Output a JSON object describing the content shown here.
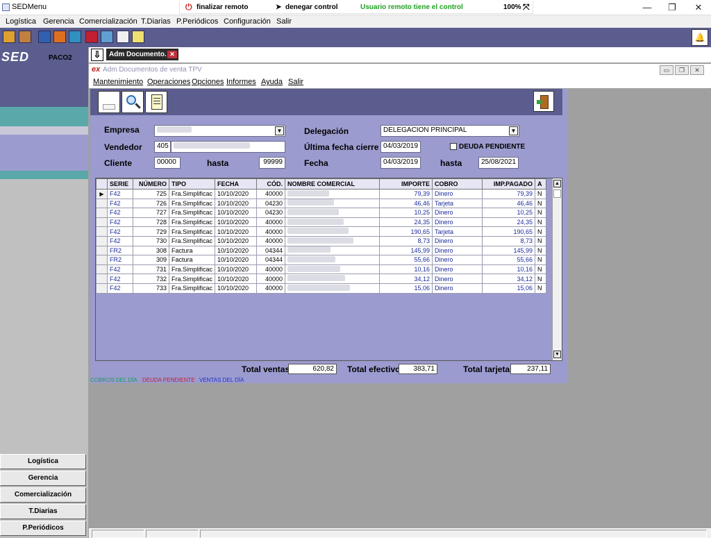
{
  "window": {
    "title": "SEDMenu",
    "minimize": "—",
    "restore": "❐",
    "close": "✕"
  },
  "remote": {
    "end_remote": "finalizar remoto",
    "deny_control": "denegar control",
    "status": "Usuario remoto tiene el control",
    "zoom": "100%",
    "pin": "⤧"
  },
  "main_menu": [
    "Logística",
    "Gerencia",
    "Comercialización",
    "T.Diarias",
    "P.Periódicos",
    "Configuración",
    "Salir"
  ],
  "toolbar": {
    "icons": [
      "globe-icon",
      "box-icon",
      "people-icon",
      "users-icon",
      "chart-icon",
      "book-icon",
      "calculator-icon",
      "pencil-icon",
      "edit-icon"
    ],
    "icon_colors": [
      "#e0a030",
      "#c08040",
      "#3060b0",
      "#e07020",
      "#3090c0",
      "#c02030",
      "#60a0d0",
      "#f0f0f0",
      "#f0e070"
    ],
    "bell": "🔔"
  },
  "left": {
    "logo": "SED",
    "user": "PACO2",
    "nav": [
      "Logística",
      "Gerencia",
      "Comercialización",
      "T.Diarias",
      "P.Periódicos"
    ]
  },
  "tab": {
    "label": "Adm Documento.",
    "close": "✕",
    "arrow": "⇩"
  },
  "child": {
    "title_prefix": "ex",
    "title": "Adm Documentos de venta TPV",
    "menu": [
      "Mantenimiento",
      "Operaciones",
      "Opciones",
      "Informes",
      "Ayuda",
      "Salir"
    ]
  },
  "form": {
    "empresa_label": "Empresa",
    "vendedor_label": "Vendedor",
    "vendedor_value": "405",
    "cliente_label": "Cliente",
    "cliente_from": "00000",
    "hasta_label": "hasta",
    "cliente_to": "99999",
    "delegacion_label": "Delegación",
    "delegacion_value": "DELEGACION PRINCIPAL",
    "ultima_label": "Última fecha cierre",
    "ultima_value": "04/03/2019",
    "deuda_label": "DEUDA PENDIENTE",
    "fecha_label": "Fecha",
    "fecha_from": "04/03/2019",
    "fecha_to": "25/08/2021"
  },
  "grid": {
    "columns": [
      "SERIE",
      "NÚMERO",
      "TIPO",
      "FECHA",
      "CÓD.",
      "NOMBRE COMERCIAL",
      "IMPORTE",
      "COBRO",
      "IMP.PAGADO",
      "A"
    ],
    "rows": [
      [
        "F42",
        "725",
        "Fra.Simplificac",
        "10/10/2020",
        "40000",
        "",
        "79,39",
        "Dinero",
        "79,39",
        "N"
      ],
      [
        "F42",
        "726",
        "Fra.Simplificac",
        "10/10/2020",
        "04230",
        "",
        "46,46",
        "Tarjeta",
        "46,46",
        "N"
      ],
      [
        "F42",
        "727",
        "Fra.Simplificac",
        "10/10/2020",
        "04230",
        "",
        "10,25",
        "Dinero",
        "10,25",
        "N"
      ],
      [
        "F42",
        "728",
        "Fra.Simplificac",
        "10/10/2020",
        "40000",
        "",
        "24,35",
        "Dinero",
        "24,35",
        "N"
      ],
      [
        "F42",
        "729",
        "Fra.Simplificac",
        "10/10/2020",
        "40000",
        "",
        "190,65",
        "Tarjeta",
        "190,65",
        "N"
      ],
      [
        "F42",
        "730",
        "Fra.Simplificac",
        "10/10/2020",
        "40000",
        "",
        "8,73",
        "Dinero",
        "8,73",
        "N"
      ],
      [
        "FR2",
        "308",
        "Factura",
        "10/10/2020",
        "04344",
        "",
        "145,99",
        "Dinero",
        "145,99",
        "N"
      ],
      [
        "FR2",
        "309",
        "Factura",
        "10/10/2020",
        "04344",
        "",
        "55,66",
        "Dinero",
        "55,66",
        "N"
      ],
      [
        "F42",
        "731",
        "Fra.Simplificac",
        "10/10/2020",
        "40000",
        "",
        "10,16",
        "Dinero",
        "10,16",
        "N"
      ],
      [
        "F42",
        "732",
        "Fra.Simplificac",
        "10/10/2020",
        "40000",
        "",
        "34,12",
        "Dinero",
        "34,12",
        "N"
      ],
      [
        "F42",
        "733",
        "Fra.Simplificac",
        "10/10/2020",
        "40000",
        "",
        "15,06",
        "Dinero",
        "15,06",
        "N"
      ]
    ],
    "current_row_marker": "▶",
    "scroll_up": "▲",
    "scroll_down": "▼"
  },
  "totals": {
    "ventas_label": "Total ventas",
    "ventas": "620,82",
    "efectivo_label": "Total efectivo",
    "efectivo": "383,71",
    "tarjeta_label": "Total tarjeta",
    "tarjeta": "237,11"
  },
  "legend": {
    "cobros": "COBROS DEL DÍA",
    "cobros_color": "#18a050",
    "deuda": "DEUDA PENDIENTE",
    "deuda_color": "#c02030",
    "ventas": "VENTAS DEL DÍA",
    "ventas_color": "#2030c0"
  }
}
